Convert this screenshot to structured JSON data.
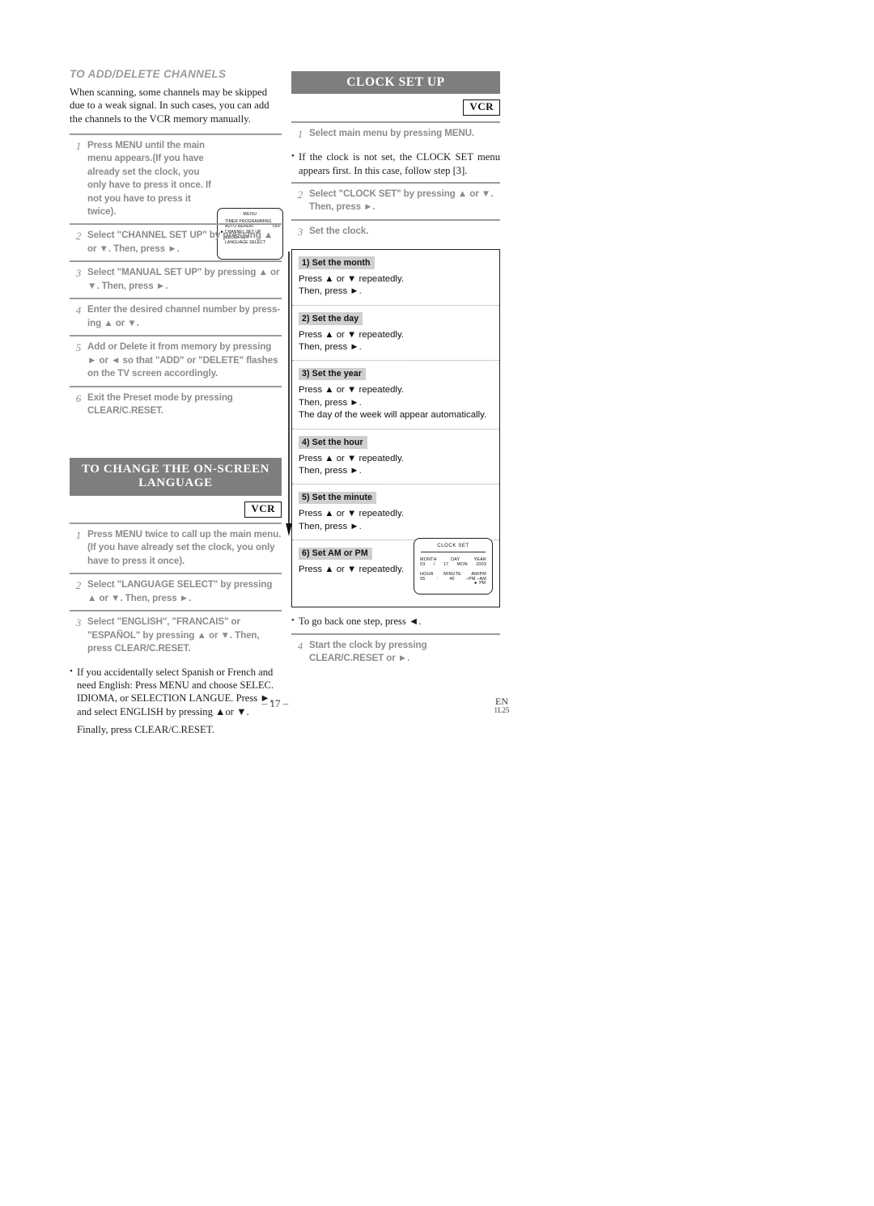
{
  "document": {
    "page_number": "– 17 –",
    "footer_lang": "EN",
    "footer_code": "1L25"
  },
  "left_column": {
    "section1": {
      "heading": "TO ADD/DELETE CHANNELS",
      "intro": "When scanning, some channels may be skipped due to a weak signal. In such cases, you can add  the channels to the VCR memory manually.",
      "steps": [
        {
          "num": "1",
          "text": "Press MENU until the main menu appears.(If you have already set the clock, you only have to press it once.  If not you have to press it twice)."
        },
        {
          "num": "2",
          "text": "Select \"CHANNEL SET UP\" by pressing ▲ or ▼. Then, press ►."
        },
        {
          "num": "3",
          "text": "Select \"MANUAL SET UP\" by pressing ▲ or ▼. Then, press ►."
        },
        {
          "num": "4",
          "text": "Enter the desired channel number by press- ing ▲ or ▼."
        },
        {
          "num": "5",
          "text": "Add or Delete it from memory by pressing ► or ◄ so that \"ADD\" or \"DELETE\" flashes on the TV screen accordingly."
        },
        {
          "num": "6",
          "text": "Exit the Preset mode by pressing CLEAR/C.RESET."
        }
      ],
      "osd_menu": {
        "title": "· MENU ·",
        "items": [
          "TIMER PROGRAMMING",
          "AUTO REPEAT",
          "CHANNEL SET UP",
          "CLOCK SET",
          "LANGUAGE SELECT"
        ],
        "auto_repeat_value": "OFF",
        "pointer": "►"
      }
    },
    "section2": {
      "heading_line1": "TO CHANGE THE ON-SCREEN",
      "heading_line2": "LANGUAGE",
      "badge": "VCR",
      "steps": [
        {
          "num": "1",
          "text": "Press MENU twice to call up the main menu. (If you have already set the clock, you only have to press it once)."
        },
        {
          "num": "2",
          "text": "Select \"LANGUAGE SELECT\" by pressing ▲ or ▼. Then, press ►."
        },
        {
          "num": "3",
          "text": "Select \"ENGLISH\", \"FRANCAIS\" or \"ESPAÑOL\" by pressing ▲ or ▼. Then, press CLEAR/C.RESET."
        }
      ],
      "note_main": "If you accidentally select Spanish or French and need English: Press MENU and choose SELEC. IDIOMA, or SELECTION LANGUE. Press ►, and select ENGLISH by pressing ▲or ▼.",
      "note_final": "Finally, press CLEAR/C.RESET."
    }
  },
  "right_column": {
    "heading": "CLOCK SET UP",
    "badge": "VCR",
    "steps": [
      {
        "num": "1",
        "text": "Select main menu by pressing MENU."
      },
      {
        "num": "2",
        "text": "Select \"CLOCK SET\" by pressing ▲ or ▼. Then, press ►."
      },
      {
        "num": "3",
        "text": "Set the clock."
      }
    ],
    "note_after_step1": "If the clock is not set, the CLOCK SET menu appears first. In this case, follow step [3].",
    "clock_items": [
      {
        "label": "1) Set the month",
        "lines": [
          "Press ▲ or ▼ repeatedly.",
          "Then, press ►."
        ]
      },
      {
        "label": "2) Set the day",
        "lines": [
          "Press ▲ or ▼ repeatedly.",
          "Then, press ►."
        ]
      },
      {
        "label": "3) Set the year",
        "lines": [
          "Press ▲ or ▼ repeatedly.",
          "Then, press ►.",
          "The day of the week will appear automatically."
        ]
      },
      {
        "label": "4) Set the hour",
        "lines": [
          "Press ▲ or ▼ repeatedly.",
          "Then, press ►."
        ]
      },
      {
        "label": "5) Set the minute",
        "lines": [
          "Press ▲ or ▼ repeatedly.",
          "Then, press ►."
        ]
      },
      {
        "label": "6) Set AM or PM",
        "lines": [
          "Press  ▲ or ▼ repeatedly."
        ]
      }
    ],
    "osd_clock": {
      "title": "CLOCK SET",
      "month_label": "MONTH",
      "day_label": "DAY",
      "year_label": "YEAR",
      "month_value": "03",
      "day_sep": "/",
      "day_value": "17",
      "weekday_value": "MON",
      "year_value": "2003",
      "hour_label": "HOUR",
      "minute_label": "MINUTE",
      "ampm_label": "AM/PM",
      "hour_value": "05",
      "time_sep": ":",
      "minute_value": "40",
      "ampm_line": "–PM –AM",
      "ampm_selected": "► PM"
    },
    "note_back": "To go back one step, press ◄.",
    "final_step": {
      "num": "4",
      "text": "Start the clock by pressing CLEAR/C.RESET or ►."
    }
  }
}
